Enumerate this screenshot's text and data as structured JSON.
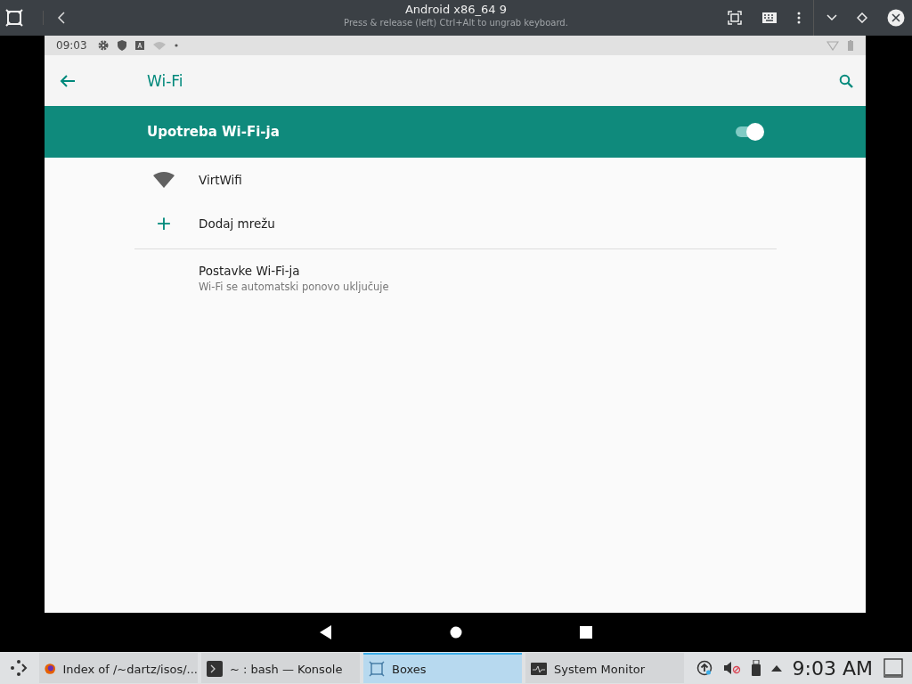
{
  "window": {
    "title": "Android x86_64 9",
    "subtitle": "Press & release (left) Ctrl+Alt to ungrab keyboard."
  },
  "status_bar": {
    "time": "09:03"
  },
  "app_bar": {
    "title": "Wi-Fi"
  },
  "master_switch": {
    "label": "Upotreba Wi-Fi-ja",
    "on": true
  },
  "items": [
    {
      "kind": "network",
      "title": "VirtWifi"
    },
    {
      "kind": "add",
      "icon": "+",
      "title": "Dodaj mrežu"
    },
    {
      "kind": "settings",
      "title": "Postavke Wi-Fi-ja",
      "subtitle": "Wi-Fi se automatski ponovo uključuje"
    }
  ],
  "taskbar": {
    "tasks": [
      {
        "kind": "browser",
        "label": "Index of /~dartz/isos/...",
        "selected": false
      },
      {
        "kind": "terminal",
        "label": "~ : bash — Konsole",
        "selected": false
      },
      {
        "kind": "boxes",
        "label": "Boxes",
        "selected": true
      },
      {
        "kind": "monitor",
        "label": "System Monitor",
        "selected": false
      }
    ],
    "clock": "9:03 AM"
  }
}
